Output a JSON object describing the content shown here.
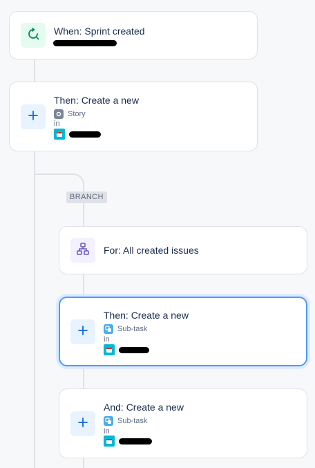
{
  "trigger": {
    "title": "When: Sprint created",
    "description": "[redacted]"
  },
  "action1": {
    "title": "Then: Create a new",
    "issue_type": "Story",
    "in_label": "in",
    "project": "[redacted]"
  },
  "branch": {
    "label": "BRANCH",
    "title": "For: All created issues"
  },
  "action2": {
    "title": "Then: Create a new",
    "issue_type": "Sub-task",
    "in_label": "in",
    "project": "[redacted]"
  },
  "action3": {
    "title": "And: Create a new",
    "issue_type": "Sub-task",
    "in_label": "in",
    "project": "[redacted]"
  },
  "colors": {
    "trigger": "#00875a",
    "action": "#0c66e4",
    "branch": "#6554c0",
    "selected_border": "#4c9aff"
  }
}
